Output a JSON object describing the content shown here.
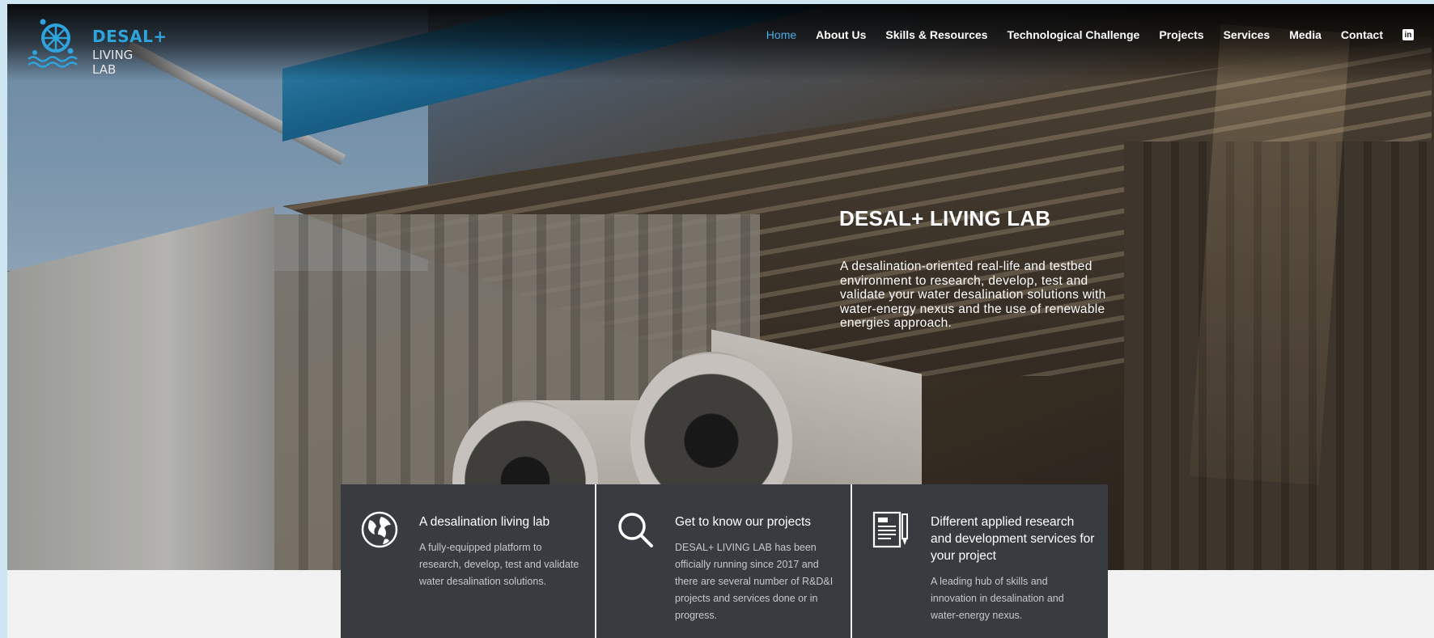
{
  "brand": {
    "line1": "DESAL+",
    "line2": "LIVING LAB",
    "logo_icon": "wheel-waves-logo"
  },
  "nav": {
    "items": [
      {
        "label": "Home",
        "active": true
      },
      {
        "label": "About Us"
      },
      {
        "label": "Skills & Resources"
      },
      {
        "label": "Technological Challenge"
      },
      {
        "label": "Projects"
      },
      {
        "label": "Services"
      },
      {
        "label": "Media"
      },
      {
        "label": "Contact"
      }
    ],
    "social_icon": "linkedin-icon",
    "social_glyph": "in"
  },
  "hero": {
    "title": "DESAL+ LIVING LAB",
    "subtitle": "A desalination-oriented real-life and testbed environment to research, develop, test and validate your water desalination solutions with water-energy nexus and the use of renewable energies approach."
  },
  "cards": [
    {
      "icon": "globe-icon",
      "title": "A desalination living lab",
      "text": "A fully-equipped platform to research, develop, test and validate water desalination solutions."
    },
    {
      "icon": "magnifier-icon",
      "title": "Get to know our projects",
      "text": "DESAL+ LIVING LAB has been officially running since 2017 and there are several number of R&D&I projects and services done or in progress."
    },
    {
      "icon": "document-pen-icon",
      "title": "Different applied research and development services for your project",
      "text": "A leading hub of skills and innovation in desalination and water-energy nexus."
    }
  ],
  "colors": {
    "accent": "#2ea3dc",
    "nav_active": "#4aaee6",
    "card_bg": "#383c40",
    "page_bg": "#f2f2f2"
  }
}
